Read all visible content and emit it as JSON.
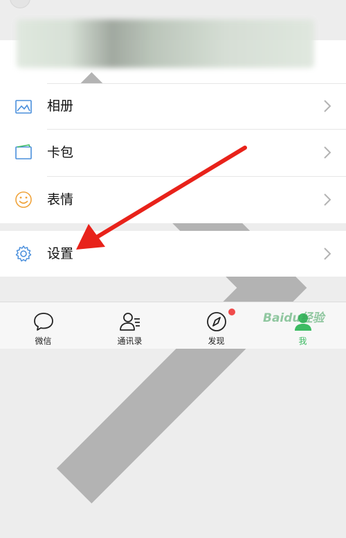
{
  "menu": {
    "items": [
      {
        "label": "相册",
        "icon": "album-icon"
      },
      {
        "label": "卡包",
        "icon": "card-wallet-icon"
      },
      {
        "label": "表情",
        "icon": "emoji-icon"
      }
    ],
    "settings": {
      "label": "设置",
      "icon": "gear-icon"
    }
  },
  "bottom_nav": {
    "items": [
      {
        "label": "微信",
        "icon": "chat-bubble-icon"
      },
      {
        "label": "通讯录",
        "icon": "contacts-icon"
      },
      {
        "label": "发现",
        "icon": "compass-icon"
      },
      {
        "label": "我",
        "icon": "me-icon"
      }
    ],
    "active_index": 3
  },
  "colors": {
    "accent_green": "#3dbb63",
    "icon_blue": "#4a8fdc",
    "emoji_orange": "#f0a33a",
    "badge_red": "#f04b4b",
    "annotation_arrow": "#e8221a"
  },
  "watermark": {
    "text": "Baidu经验"
  }
}
